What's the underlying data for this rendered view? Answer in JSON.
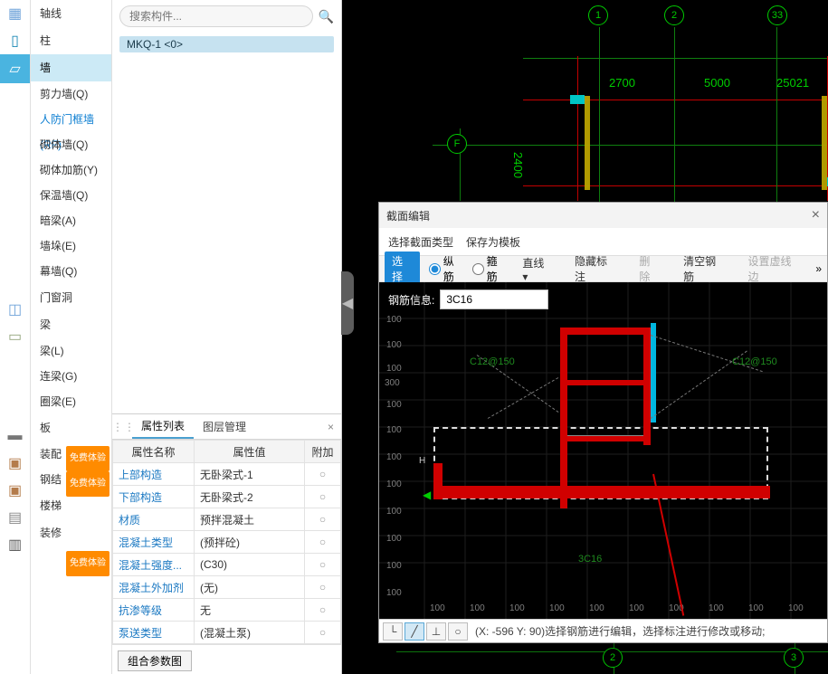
{
  "sidebar": {
    "top": [
      "轴线",
      "柱",
      "墙"
    ],
    "selectedTop": "墙",
    "walls": [
      {
        "label": "剪力墙(Q)"
      },
      {
        "label": "人防门框墙(RF)",
        "active": true
      },
      {
        "label": "砌体墙(Q)"
      },
      {
        "label": "砌体加筋(Y)"
      },
      {
        "label": "保温墙(Q)"
      },
      {
        "label": "暗梁(A)"
      },
      {
        "label": "墙垛(E)"
      },
      {
        "label": "幕墙(Q)"
      }
    ],
    "door": "门窗洞",
    "beamHead": "梁",
    "beams": [
      {
        "label": "梁(L)"
      },
      {
        "label": "连梁(G)"
      },
      {
        "label": "圈梁(E)"
      }
    ],
    "slab": "板",
    "assembly": "装配",
    "steel": "钢结",
    "stair": "楼梯",
    "decor": "装修",
    "badge": "免费体验"
  },
  "search": {
    "placeholder": "搜索构件..."
  },
  "chip": "MKQ-1  <0>",
  "tabs": {
    "prop": "属性列表",
    "layer": "图层管理"
  },
  "propCols": {
    "name": "属性名称",
    "value": "属性值",
    "extra": "附加"
  },
  "props": [
    {
      "n": "上部构造",
      "v": "无卧梁式-1"
    },
    {
      "n": "下部构造",
      "v": "无卧梁式-2"
    },
    {
      "n": "材质",
      "v": "预拌混凝土"
    },
    {
      "n": "混凝土类型",
      "v": "(预拌砼)"
    },
    {
      "n": "混凝土强度...",
      "v": "(C30)"
    },
    {
      "n": "混凝土外加剂",
      "v": "(无)"
    },
    {
      "n": "抗渗等级",
      "v": "无"
    },
    {
      "n": "泵送类型",
      "v": "(混凝土泵)"
    }
  ],
  "paramBtn": "组合参数图",
  "dlg": {
    "title": "截面编辑",
    "menu": [
      "选择截面类型",
      "保存为模板"
    ],
    "tools": {
      "select": "选择",
      "zongjin": "纵筋",
      "gujin": "箍筋",
      "line": "直线",
      "hide": "隐藏标注",
      "delete": "删除",
      "clear": "清空钢筋",
      "virtual": "设置虚线边"
    },
    "infoLabel": "钢筋信息:",
    "infoValue": "3C16",
    "ticks": [
      "100",
      "100",
      "100",
      "300",
      "100",
      "100",
      "100",
      "100",
      "100",
      "100",
      "100",
      "100"
    ],
    "bottomTicks": [
      "100",
      "100",
      "100",
      "100",
      "100",
      "100",
      "100",
      "100",
      "100",
      "100"
    ],
    "letterH": "H",
    "rebarLabels": {
      "left": "C12@150",
      "right": "C12@150",
      "bottom": "3C16"
    },
    "status": "(X: -596 Y: 90)选择钢筋进行编辑，选择标注进行修改或移动;"
  },
  "axes": {
    "cols": [
      "1",
      "2",
      "33"
    ],
    "rows": [
      "F"
    ],
    "dims": [
      "2700",
      "5000",
      "25021"
    ],
    "vdim": "2400"
  }
}
